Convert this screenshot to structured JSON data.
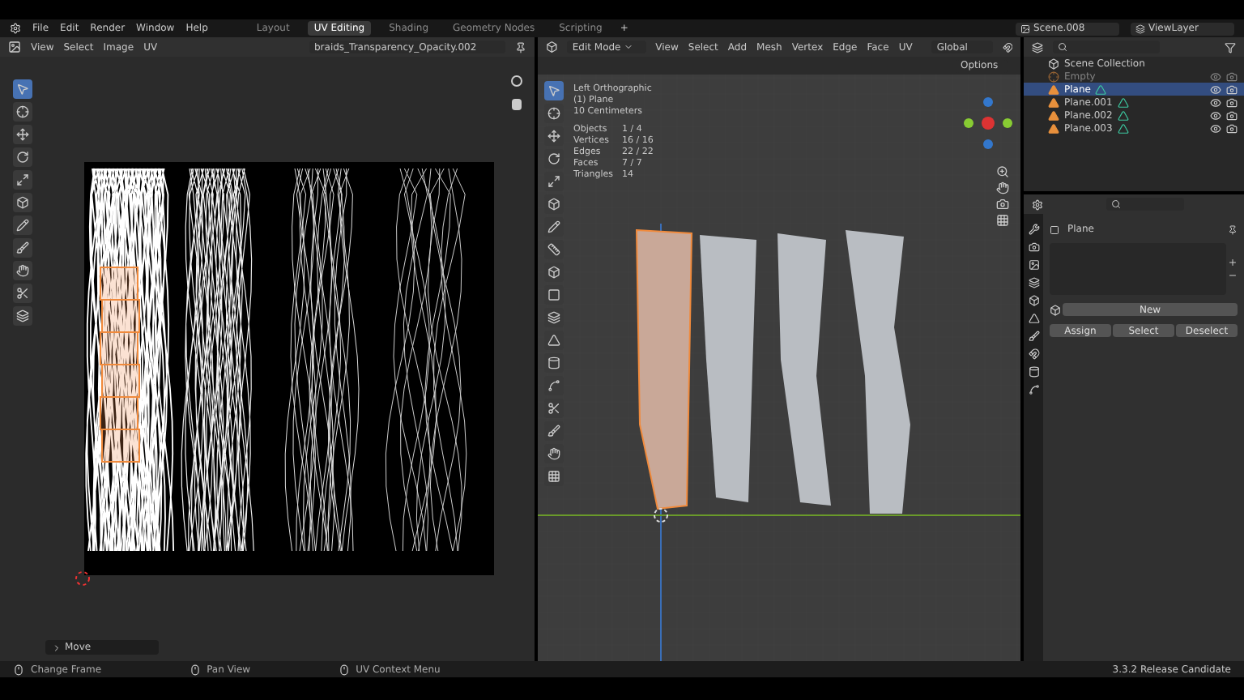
{
  "topbar": {
    "menus": [
      "File",
      "Edit",
      "Render",
      "Window",
      "Help"
    ],
    "workspaces": [
      {
        "label": "Layout",
        "selected": false
      },
      {
        "label": "UV Editing",
        "selected": true
      },
      {
        "label": "Shading",
        "selected": false
      },
      {
        "label": "Geometry Nodes",
        "selected": false
      },
      {
        "label": "Scripting",
        "selected": false
      }
    ],
    "add_tab": "+",
    "scene": "Scene.008",
    "view_layer": "ViewLayer"
  },
  "uv_editor": {
    "menus": [
      "View",
      "Select",
      "Image",
      "UV"
    ],
    "image_name": "braids_Transparency_Opacity.002",
    "tools": [
      {
        "selected": true
      },
      {
        "selected": false
      },
      {
        "selected": false
      },
      {
        "selected": false
      },
      {
        "selected": false
      },
      {
        "selected": false
      },
      {
        "selected": false
      },
      {
        "selected": false
      },
      {
        "selected": false
      },
      {
        "selected": false
      },
      {
        "selected": false
      }
    ],
    "last_operator": "Move"
  },
  "viewport": {
    "mode": "Edit Mode",
    "menus": [
      "View",
      "Select",
      "Add",
      "Mesh",
      "Vertex",
      "Edge",
      "Face",
      "UV"
    ],
    "orientation": "Global",
    "options": "Options",
    "overlay": {
      "view": "Left Orthographic",
      "object": "(1) Plane",
      "scale": "10 Centimeters",
      "stats": [
        {
          "label": "Objects",
          "value": "1 / 4"
        },
        {
          "label": "Vertices",
          "value": "16 / 16"
        },
        {
          "label": "Edges",
          "value": "22 / 22"
        },
        {
          "label": "Faces",
          "value": "7 / 7"
        },
        {
          "label": "Triangles",
          "value": "14"
        }
      ]
    },
    "tools": [
      {
        "selected": true
      },
      {
        "selected": false
      },
      {
        "selected": false
      },
      {
        "selected": false
      },
      {
        "selected": false
      },
      {
        "selected": false
      },
      {
        "selected": false
      },
      {
        "selected": false
      },
      {
        "selected": false
      },
      {
        "selected": false
      },
      {
        "selected": false
      },
      {
        "selected": false
      },
      {
        "selected": false
      },
      {
        "selected": false
      },
      {
        "selected": false
      },
      {
        "selected": false
      },
      {
        "selected": false
      },
      {
        "selected": false
      }
    ]
  },
  "outliner": {
    "root": "Scene Collection",
    "items": [
      {
        "name": "Empty",
        "kind": "empty",
        "selected": false
      },
      {
        "name": "Plane",
        "kind": "mesh",
        "selected": true
      },
      {
        "name": "Plane.001",
        "kind": "mesh",
        "selected": false
      },
      {
        "name": "Plane.002",
        "kind": "mesh",
        "selected": false
      },
      {
        "name": "Plane.003",
        "kind": "mesh",
        "selected": false
      }
    ]
  },
  "properties": {
    "object": "Plane",
    "new_button": "New",
    "actions": [
      "Assign",
      "Select",
      "Deselect"
    ]
  },
  "status_bar": {
    "hints": [
      "Change Frame",
      "Pan View",
      "UV Context Menu"
    ],
    "version": "3.3.2 Release Candidate"
  }
}
